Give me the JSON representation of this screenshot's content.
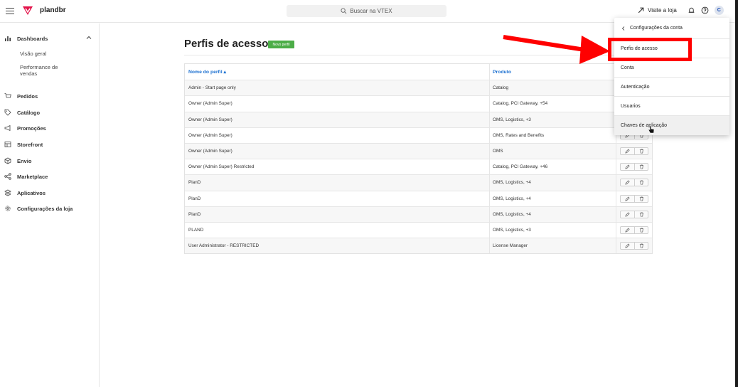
{
  "topbar": {
    "brand": "plandbr",
    "search_placeholder": "Buscar na VTEX",
    "visit_store": "Visite a loja",
    "avatar_initial": "C"
  },
  "sidebar": {
    "dashboards": "Dashboards",
    "sub": [
      "Visão geral",
      "Performance de vendas"
    ],
    "items": [
      "Pedidos",
      "Catálogo",
      "Promoções",
      "Storefront",
      "Envio",
      "Marketplace",
      "Aplicativos",
      "Configurações da loja"
    ]
  },
  "main": {
    "title": "Perfis de acesso",
    "new_button": "Novo perfil",
    "columns": [
      "Nome do perfil ▴",
      "Produto"
    ],
    "rows": [
      {
        "name": "Admin - Start page only",
        "product": "Catalog"
      },
      {
        "name": "Owner (Admin Super)",
        "product": "Catalog, PCI Gateway, +54"
      },
      {
        "name": "Owner (Admin Super)",
        "product": "OMS, Logistics, +3"
      },
      {
        "name": "Owner (Admin Super)",
        "product": "OMS, Rates and Benefits"
      },
      {
        "name": "Owner (Admin Super)",
        "product": "OMS"
      },
      {
        "name": "Owner (Admin Super) Restricted",
        "product": "Catalog, PCI Gateway, +46"
      },
      {
        "name": "PlanD",
        "product": "OMS, Logistics, +4"
      },
      {
        "name": "PlanD",
        "product": "OMS, Logistics, +4"
      },
      {
        "name": "PlanD",
        "product": "OMS, Logistics, +4"
      },
      {
        "name": "PLAND",
        "product": "OMS, Logistics, +3"
      },
      {
        "name": "User Administrator - RESTRICTED",
        "product": "License Manager"
      }
    ]
  },
  "dropdown": {
    "header": "Configurações da conta",
    "items": [
      "Perfis de acesso",
      "Conta",
      "Autenticação",
      "Usuarios",
      "Chaves de aplicação"
    ]
  },
  "colors": {
    "brand": "#e3144a",
    "link": "#1a6fd0",
    "new_button": "#4cad47",
    "highlight": "#ff0000"
  }
}
